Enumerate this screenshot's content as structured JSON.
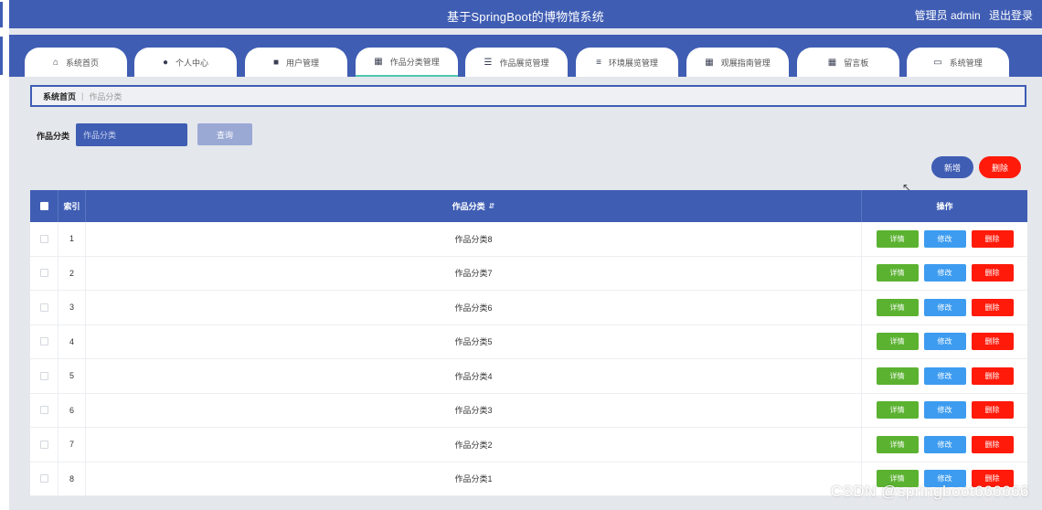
{
  "header": {
    "title": "基于SpringBoot的博物馆系统",
    "user_label": "管理员 admin",
    "logout_label": "退出登录"
  },
  "nav": {
    "tabs": [
      {
        "label": "系统首页",
        "icon": "home-icon"
      },
      {
        "label": "个人中心",
        "icon": "user-icon"
      },
      {
        "label": "用户管理",
        "icon": "briefcase-icon"
      },
      {
        "label": "作品分类管理",
        "icon": "grid-icon"
      },
      {
        "label": "作品展览管理",
        "icon": "list-icon"
      },
      {
        "label": "环境展览管理",
        "icon": "sliders-icon"
      },
      {
        "label": "观展指南管理",
        "icon": "grid-icon"
      },
      {
        "label": "留言板",
        "icon": "grid-icon"
      },
      {
        "label": "系统管理",
        "icon": "chart-icon"
      }
    ],
    "active_index": 3
  },
  "breadcrumb": {
    "home": "系统首页",
    "current": "作品分类"
  },
  "search": {
    "label": "作品分类",
    "placeholder": "作品分类",
    "button": "查询"
  },
  "actions": {
    "add": "新增",
    "delete": "删除"
  },
  "table": {
    "columns": {
      "index": "索引",
      "name": "作品分类",
      "ops": "操作"
    },
    "op_labels": {
      "detail": "详情",
      "edit": "修改",
      "remove": "删除"
    },
    "rows": [
      {
        "index": "1",
        "name": "作品分类8"
      },
      {
        "index": "2",
        "name": "作品分类7"
      },
      {
        "index": "3",
        "name": "作品分类6"
      },
      {
        "index": "4",
        "name": "作品分类5"
      },
      {
        "index": "5",
        "name": "作品分类4"
      },
      {
        "index": "6",
        "name": "作品分类3"
      },
      {
        "index": "7",
        "name": "作品分类2"
      },
      {
        "index": "8",
        "name": "作品分类1"
      }
    ]
  },
  "watermark": "CSDN @springboot666666",
  "colors": {
    "primary": "#3f5db3",
    "danger": "#ff1a0a",
    "success": "#5bb231",
    "info": "#3d9cf0"
  }
}
